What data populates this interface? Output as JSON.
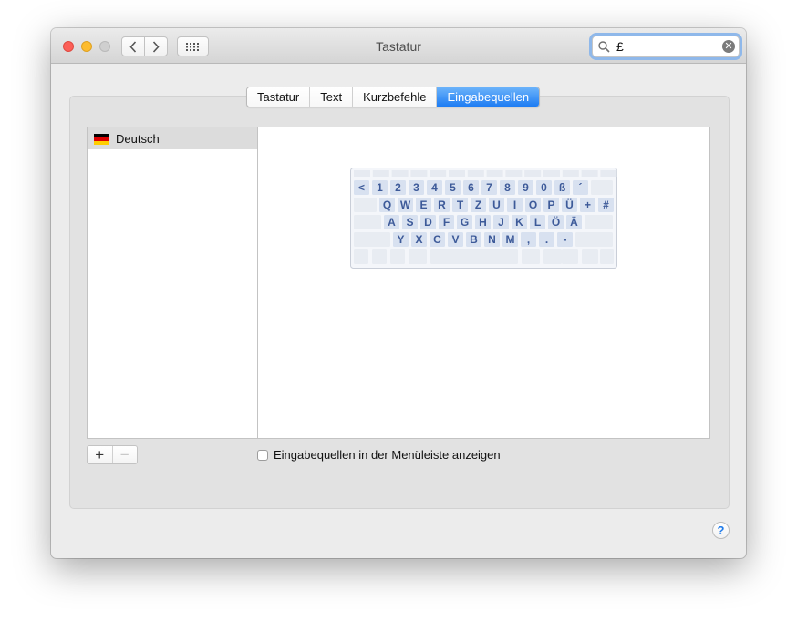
{
  "window": {
    "title": "Tastatur"
  },
  "search": {
    "value": "£"
  },
  "tabs": [
    {
      "label": "Tastatur",
      "active": false
    },
    {
      "label": "Text",
      "active": false
    },
    {
      "label": "Kurzbefehle",
      "active": false
    },
    {
      "label": "Eingabequellen",
      "active": true
    }
  ],
  "input_sources": [
    {
      "label": "Deutsch",
      "selected": true
    }
  ],
  "keyboard_rows": [
    [
      "<",
      "1",
      "2",
      "3",
      "4",
      "5",
      "6",
      "7",
      "8",
      "9",
      "0",
      "ß",
      "´"
    ],
    [
      "Q",
      "W",
      "E",
      "R",
      "T",
      "Z",
      "U",
      "I",
      "O",
      "P",
      "Ü",
      "+",
      "#"
    ],
    [
      "A",
      "S",
      "D",
      "F",
      "G",
      "H",
      "J",
      "K",
      "L",
      "Ö",
      "Ä"
    ],
    [
      "Y",
      "X",
      "C",
      "V",
      "B",
      "N",
      "M",
      ",",
      ".",
      "-"
    ]
  ],
  "show_in_menubar": {
    "label": "Eingabequellen in der Menüleiste anzeigen",
    "checked": false
  },
  "buttons": {
    "add": "+",
    "remove": "−",
    "help": "?"
  },
  "colors": {
    "accent": "#1d7cf3",
    "flag": [
      "#000000",
      "#dd0000",
      "#ffce00"
    ],
    "key_label": "#3d5a99",
    "key_active": "#d8e1f0"
  }
}
